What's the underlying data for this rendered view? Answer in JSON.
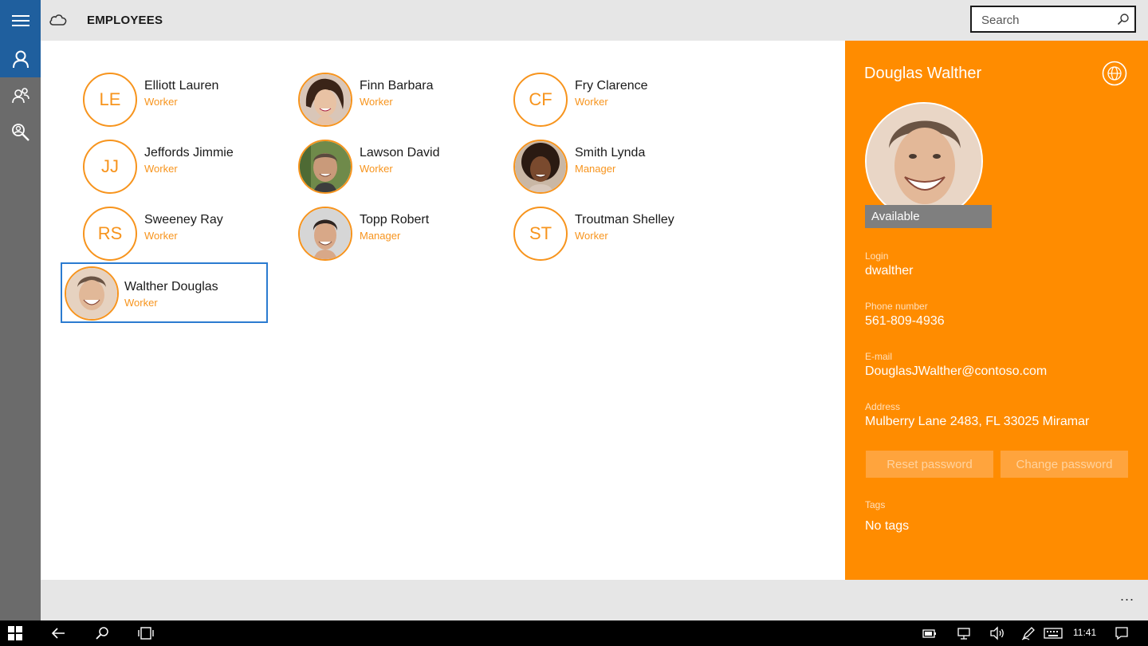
{
  "app": {
    "title": "EMPLOYEES"
  },
  "search": {
    "placeholder": "Search"
  },
  "nav": {
    "items": [
      "menu-icon",
      "person-icon",
      "people-icon",
      "people-search-icon"
    ]
  },
  "employees": [
    {
      "name": "Elliott Lauren",
      "role": "Worker",
      "initials": "LE"
    },
    {
      "name": "Finn Barbara",
      "role": "Worker",
      "initials": ""
    },
    {
      "name": "Fry Clarence",
      "role": "Worker",
      "initials": "CF"
    },
    {
      "name": "Jeffords Jimmie",
      "role": "Worker",
      "initials": "JJ"
    },
    {
      "name": "Lawson David",
      "role": "Worker",
      "initials": ""
    },
    {
      "name": "Smith Lynda",
      "role": "Manager",
      "initials": ""
    },
    {
      "name": "Sweeney Ray",
      "role": "Worker",
      "initials": "RS"
    },
    {
      "name": "Topp Robert",
      "role": "Manager",
      "initials": ""
    },
    {
      "name": "Troutman Shelley",
      "role": "Worker",
      "initials": "ST"
    },
    {
      "name": "Walther Douglas",
      "role": "Worker",
      "initials": ""
    }
  ],
  "detail": {
    "name": "Douglas Walther",
    "status": "Available",
    "fields": [
      {
        "label": "Login",
        "value": "dwalther"
      },
      {
        "label": "Phone number",
        "value": "561-809-4936"
      },
      {
        "label": "E-mail",
        "value": "DouglasJWalther@contoso.com"
      },
      {
        "label": "Address",
        "value": "Mulberry Lane 2483, FL 33025 Miramar"
      }
    ],
    "reset_label": "Reset password",
    "change_label": "Change password",
    "tags_label": "Tags",
    "tags_value": "No tags"
  },
  "appbar": {
    "more": "..."
  },
  "taskbar": {
    "time": "11:41"
  },
  "colors": {
    "accent": "#ff8c00",
    "avatar_ring": "#f7941d",
    "selection": "#2b7bd0",
    "nav_active": "#1f5f9e"
  }
}
